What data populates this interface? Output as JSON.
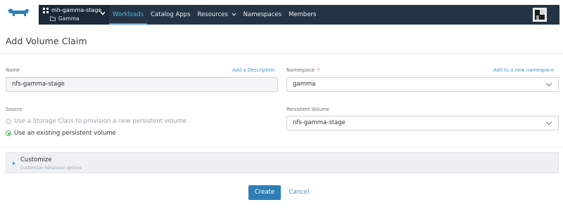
{
  "header": {
    "logo_icon": "rancher-cow-logo",
    "cluster": {
      "name": "mh-gamma-stage",
      "project": "Gamma",
      "cluster_icon": "grid-icon",
      "project_icon": "folder-icon"
    },
    "nav": [
      {
        "label": "Workloads",
        "active": true
      },
      {
        "label": "Catalog Apps",
        "active": false
      },
      {
        "label": "Resources",
        "active": false,
        "dropdown": true
      },
      {
        "label": "Namespaces",
        "active": false
      },
      {
        "label": "Members",
        "active": false
      }
    ],
    "colors": {
      "navbar": "#243444",
      "accent": "#3d98d3"
    }
  },
  "page": {
    "title": "Add Volume Claim"
  },
  "form": {
    "name": {
      "label": "Name",
      "value": "nfs-gamma-stage",
      "link": "Add a Description"
    },
    "namespace": {
      "label": "Namespace",
      "required_mark": "*",
      "value": "gamma",
      "link": "Add to a new namespace"
    },
    "source": {
      "label": "Source",
      "options": [
        {
          "label": "Use a Storage Class to provision a new persistent volume",
          "checked": false,
          "disabled": true
        },
        {
          "label": "Use an existing persistent volume",
          "checked": true,
          "disabled": false
        }
      ]
    },
    "persistent_volume": {
      "label": "Persistent Volume",
      "value": "nfs-gamma-stage"
    }
  },
  "customize": {
    "title": "Customize",
    "subtitle": "Customize Advanced options"
  },
  "actions": {
    "create": "Create",
    "cancel": "Cancel"
  }
}
